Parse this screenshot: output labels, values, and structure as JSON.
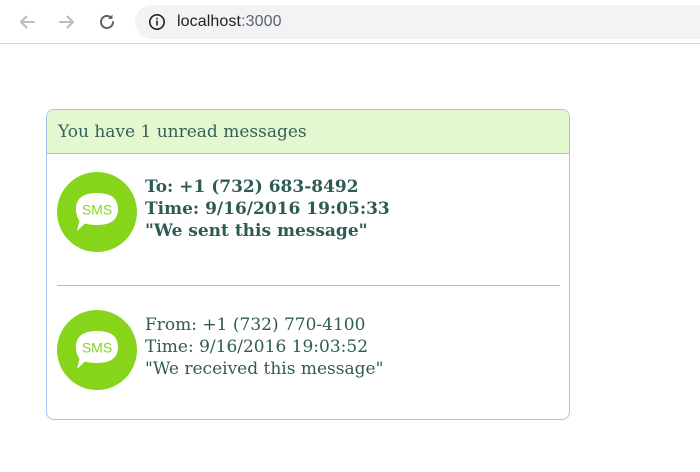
{
  "browser": {
    "url_host": "localhost",
    "url_port": ":3000"
  },
  "panel": {
    "header": "You have 1 unread messages",
    "messages": [
      {
        "icon": "sms-icon",
        "icon_label": "SMS",
        "line1": "To: +1 (732) 683-8492",
        "line2": "Time: 9/16/2016 19:05:33",
        "line3": "\"We sent this message\""
      },
      {
        "icon": "sms-icon",
        "icon_label": "SMS",
        "line1": "From: +1 (732) 770-4100",
        "line2": "Time: 9/16/2016 19:03:52",
        "line3": "\"We received this message\""
      }
    ]
  },
  "colors": {
    "header_bg": "#e4f8cf",
    "border": "#a7bfe8",
    "text": "#2f5b55",
    "sms_green": "#86d51a"
  }
}
